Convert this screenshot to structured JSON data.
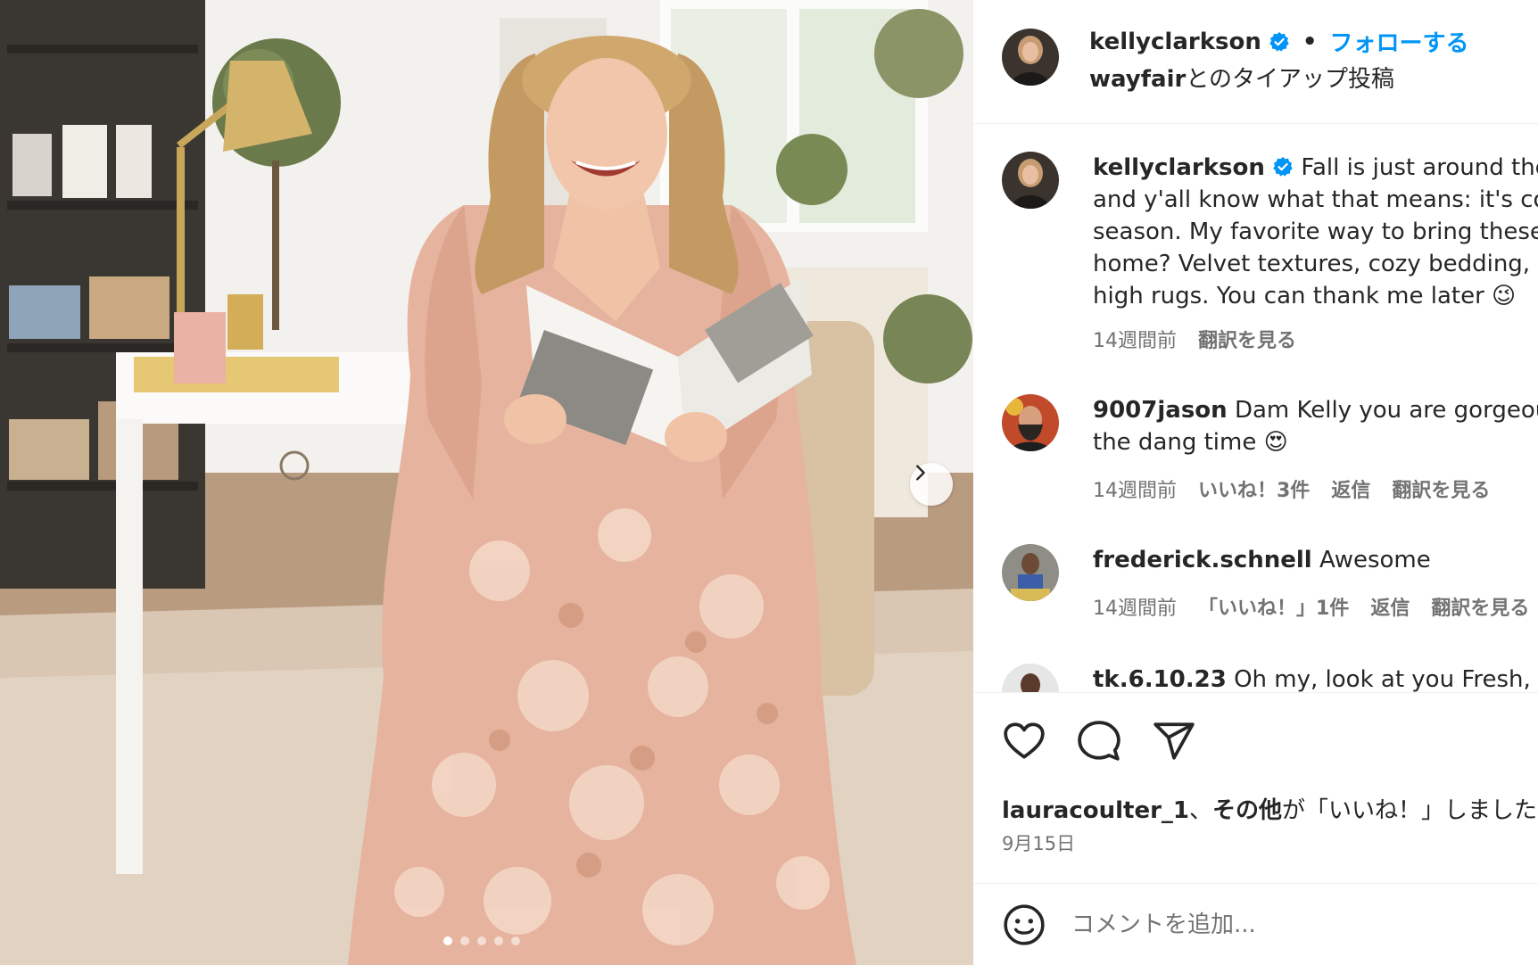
{
  "post": {
    "author": "kellyclarkson",
    "separator": "•",
    "follow_label": "フォローする",
    "partner_brand": "wayfair",
    "partner_suffix": "とのタイアップ投稿",
    "photo_alt": "photo",
    "carousel": {
      "count": 5,
      "active_index": 0
    }
  },
  "comments": [
    {
      "user": "kellyclarkson",
      "verified": true,
      "lines": [
        "Fall is just around the corner",
        "and y'all know what that means: it's cozy",
        "season. My favorite way to bring these vibes",
        "home? Velvet textures, cozy bedding, and",
        "high rugs. You can thank me later 😉"
      ],
      "time": "14週間前",
      "actions": [
        "翻訳を見る"
      ]
    },
    {
      "user": "9007jason",
      "verified": false,
      "lines": [
        "Dam Kelly you are gorgeous all",
        "the dang time 😍"
      ],
      "time": "14週間前",
      "actions": [
        "いいね！3件",
        "返信",
        "翻訳を見る"
      ]
    },
    {
      "user": "frederick.schnell",
      "verified": false,
      "lines": [
        "Awesome"
      ],
      "time": "14週間前",
      "actions": [
        "「いいね！」1件",
        "返信",
        "翻訳を見る"
      ]
    },
    {
      "user": "tk.6.10.23",
      "verified": false,
      "lines": [
        "Oh my, look at you Fresh, you"
      ],
      "time": "",
      "actions": []
    }
  ],
  "likes": {
    "user": "lauracoulter_1",
    "mid": "、",
    "others": "その他",
    "suffix": "が「いいね！」しました"
  },
  "date": "9月15日",
  "add_comment": {
    "placeholder": "コメントを追加..."
  },
  "icons": {
    "like": "heart-icon",
    "comment": "comment-icon",
    "share": "paper-plane-icon",
    "emoji": "smiley-icon",
    "verified": "verified-badge-icon",
    "next": "chevron-right-icon"
  },
  "colors": {
    "accent": "#0095f6",
    "verified": "#0095f6",
    "muted": "#737373",
    "text": "#262626"
  }
}
